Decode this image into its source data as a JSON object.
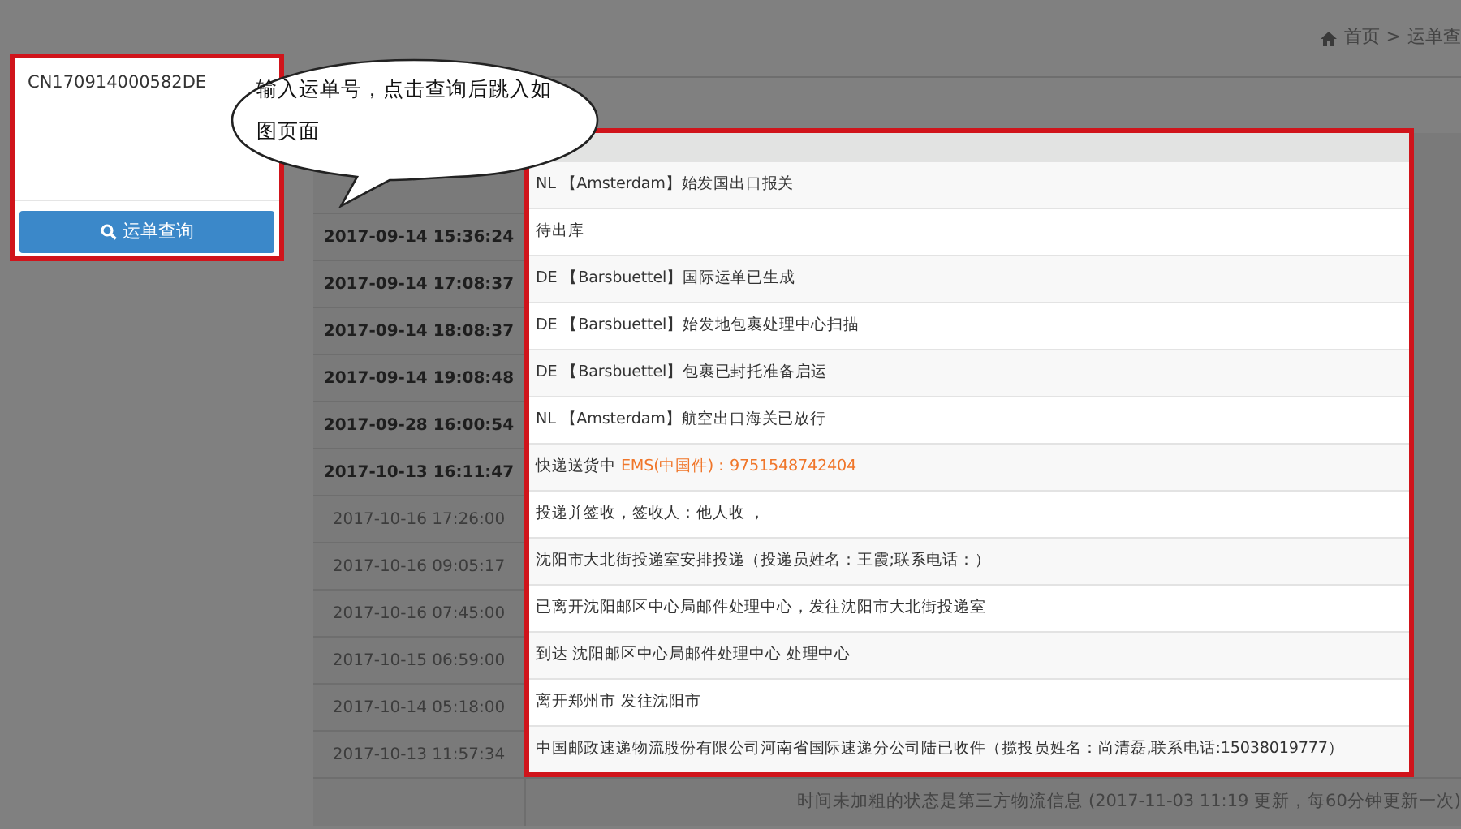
{
  "search_panel": {
    "tracking_number": "CN170914000582DE",
    "button": "运单查询"
  },
  "callout": {
    "text": "输入运单号，点击查询后跳入如图页面"
  },
  "breadcrumb": {
    "home": "首页",
    "separator": ">",
    "current": "运单查"
  },
  "tracking": {
    "rows": [
      {
        "event": "NL 【Amsterdam】始发国出口报关"
      },
      {
        "time": "2017-09-14 15:36:24",
        "event": "待出库",
        "bold": true
      },
      {
        "time": "2017-09-14 17:08:37",
        "event": "DE 【Barsbuettel】国际运单已生成",
        "bold": true
      },
      {
        "time": "2017-09-14 18:08:37",
        "event": "DE 【Barsbuettel】始发地包裹处理中心扫描",
        "bold": true
      },
      {
        "time": "2017-09-14 19:08:48",
        "event": "DE 【Barsbuettel】包裹已封托准备启运",
        "bold": true
      },
      {
        "time": "2017-09-28 16:00:54",
        "event": "NL 【Amsterdam】航空出口海关已放行",
        "bold": true
      },
      {
        "time": "2017-10-13 16:11:47",
        "event": "快递送货中 ",
        "link": "EMS(中国件)：9751548742404",
        "bold": true
      },
      {
        "time": "2017-10-16 17:26:00",
        "event": "投递并签收，签收人：他人收 ，",
        "bold": false
      },
      {
        "time": "2017-10-16 09:05:17",
        "event": "沈阳市大北街投递室安排投递（投递员姓名：王霞;联系电话：）",
        "bold": false
      },
      {
        "time": "2017-10-16 07:45:00",
        "event": "已离开沈阳邮区中心局邮件处理中心，发往沈阳市大北街投递室",
        "bold": false
      },
      {
        "time": "2017-10-15 06:59:00",
        "event": "到达 沈阳邮区中心局邮件处理中心 处理中心",
        "bold": false
      },
      {
        "time": "2017-10-14 05:18:00",
        "event": "离开郑州市 发往沈阳市",
        "bold": false
      },
      {
        "time": "2017-10-13 11:57:34",
        "event": "中国邮政速递物流股份有限公司河南省国际速递分公司陆已收件（揽投员姓名：尚清磊,联系电话:15038019777）",
        "bold": false
      }
    ],
    "note": "时间未加粗的状态是第三方物流信息 (2017-11-03 11:19 更新，每60分钟更新一次)"
  }
}
